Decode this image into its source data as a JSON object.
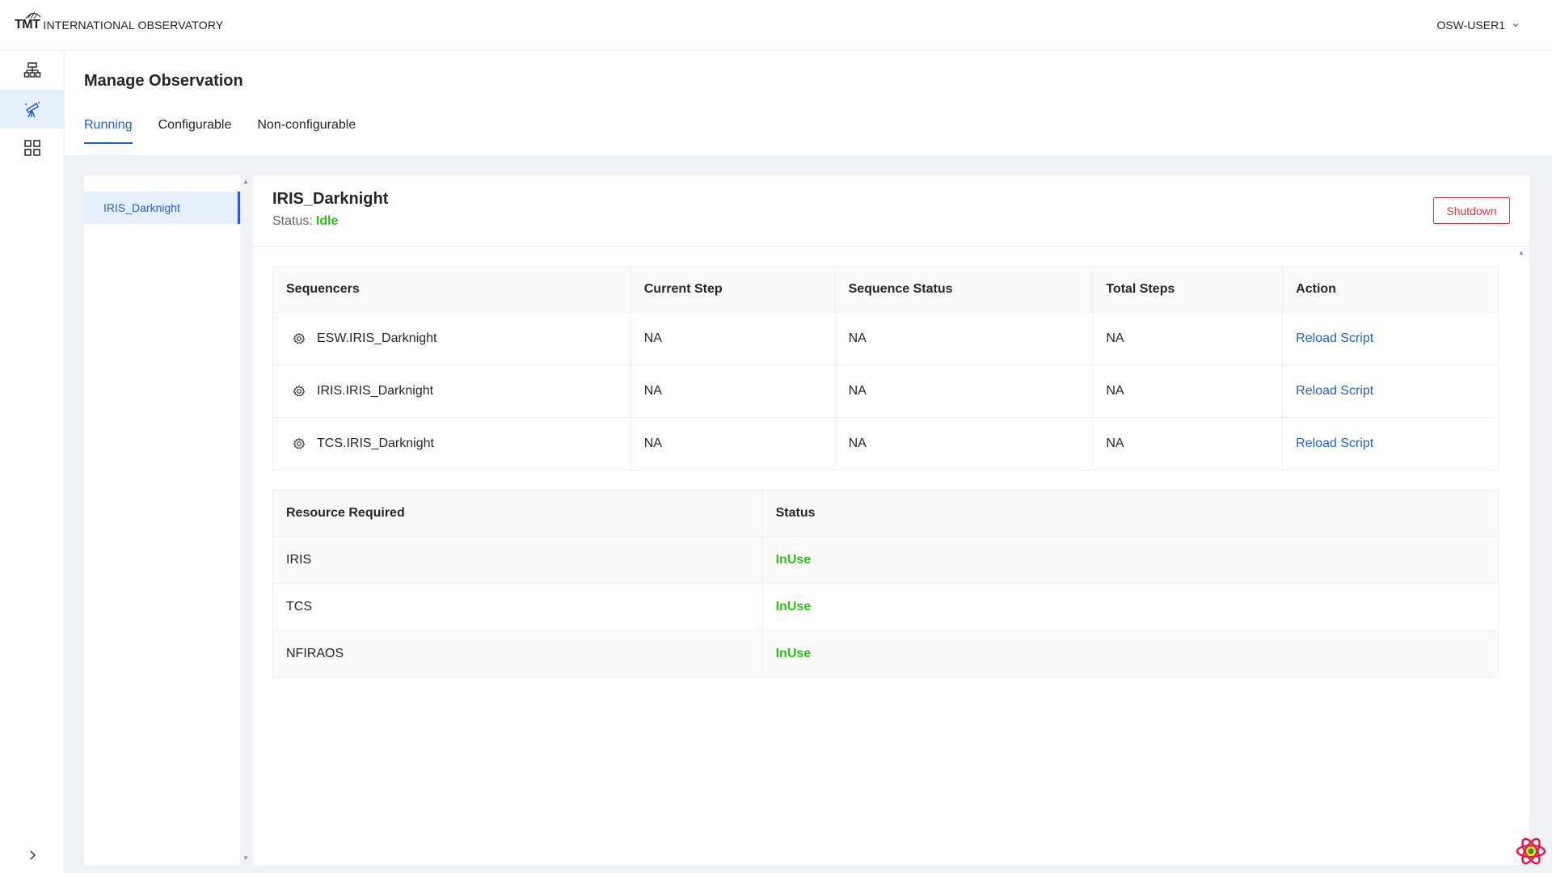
{
  "header": {
    "brand_short": "TMT",
    "brand_org": "INTERNATIONAL OBSERVATORY",
    "user": "OSW-USER1"
  },
  "sidenav": {
    "items": [
      {
        "icon": "sitemap-icon",
        "active": false
      },
      {
        "icon": "telescope-icon",
        "active": true
      },
      {
        "icon": "grid-icon",
        "active": false
      }
    ],
    "expand_icon": "chevron-right-icon"
  },
  "page": {
    "title": "Manage Observation",
    "tabs": [
      {
        "label": "Running",
        "active": true
      },
      {
        "label": "Configurable",
        "active": false
      },
      {
        "label": "Non-configurable",
        "active": false
      }
    ]
  },
  "list": {
    "items": [
      {
        "label": "IRIS_Darknight",
        "selected": true
      }
    ]
  },
  "detail": {
    "name": "IRIS_Darknight",
    "status_label": "Status:",
    "status_value": "Idle",
    "shutdown_label": "Shutdown",
    "sequencers": {
      "headers": [
        "Sequencers",
        "Current Step",
        "Sequence Status",
        "Total Steps",
        "Action"
      ],
      "rows": [
        {
          "name": "ESW.IRIS_Darknight",
          "current_step": "NA",
          "sequence_status": "NA",
          "total_steps": "NA",
          "action": "Reload Script"
        },
        {
          "name": "IRIS.IRIS_Darknight",
          "current_step": "NA",
          "sequence_status": "NA",
          "total_steps": "NA",
          "action": "Reload Script"
        },
        {
          "name": "TCS.IRIS_Darknight",
          "current_step": "NA",
          "sequence_status": "NA",
          "total_steps": "NA",
          "action": "Reload Script"
        }
      ]
    },
    "resources": {
      "headers": [
        "Resource Required",
        "Status"
      ],
      "rows": [
        {
          "name": "IRIS",
          "status": "InUse"
        },
        {
          "name": "TCS",
          "status": "InUse"
        },
        {
          "name": "NFIRAOS",
          "status": "InUse"
        }
      ]
    }
  },
  "colors": {
    "accent": "#1f5fd6",
    "success": "#2fc21b",
    "danger": "#e8323c"
  }
}
